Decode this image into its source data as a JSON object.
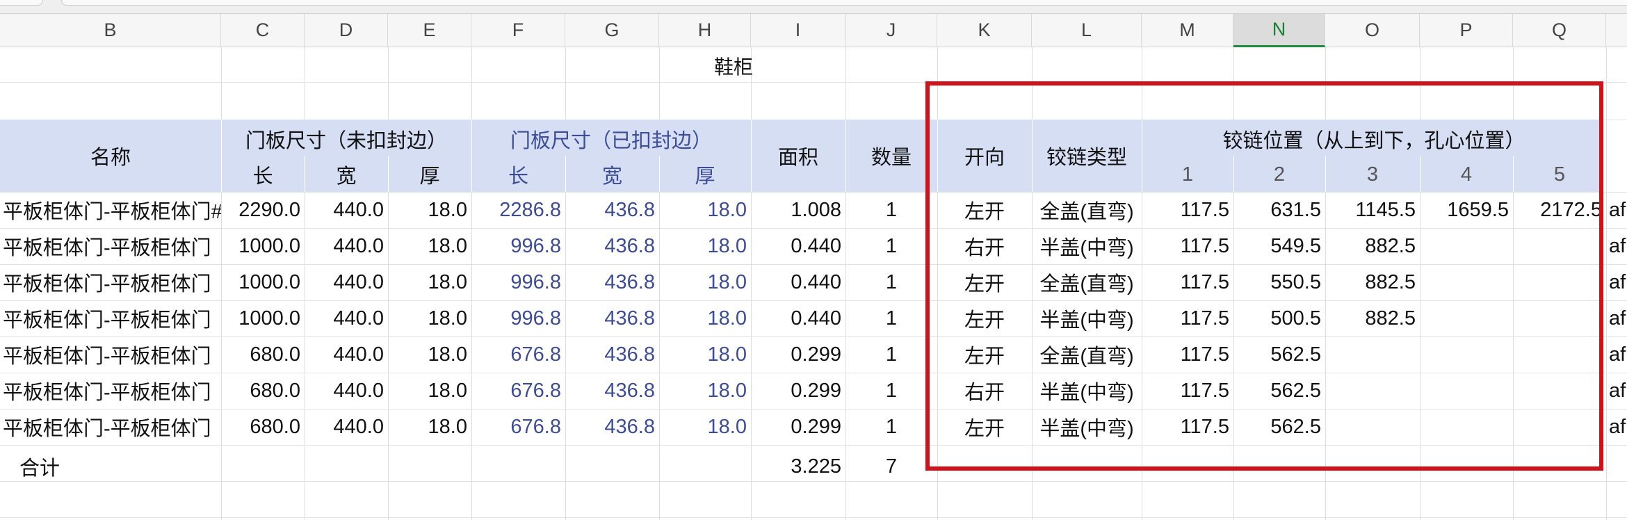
{
  "columns": [
    "B",
    "C",
    "D",
    "E",
    "F",
    "G",
    "H",
    "I",
    "J",
    "K",
    "L",
    "M",
    "N",
    "O",
    "P",
    "Q"
  ],
  "selected_column": "N",
  "sheet_title": "鞋柜",
  "header": {
    "name": "名称",
    "group_unsealed": "门板尺寸（未扣封边）",
    "group_sealed": "门板尺寸（已扣封边）",
    "length": "长",
    "width": "宽",
    "thickness": "厚",
    "area": "面积",
    "quantity": "数量",
    "direction": "开向",
    "hinge_type": "铰链类型",
    "hinge_position": "铰链位置（从上到下，孔心位置）",
    "positions": [
      "1",
      "2",
      "3",
      "4",
      "5"
    ]
  },
  "rows": [
    {
      "name": "平板柜体门-平板柜体门#",
      "l1": "2290.0",
      "w1": "440.0",
      "t1": "18.0",
      "l2": "2286.8",
      "w2": "436.8",
      "t2": "18.0",
      "area": "1.008",
      "qty": "1",
      "dir": "左开",
      "type": "全盖(直弯)",
      "p": [
        "117.5",
        "631.5",
        "1145.5",
        "1659.5",
        "2172.5"
      ],
      "extra": "af"
    },
    {
      "name": "平板柜体门-平板柜体门",
      "l1": "1000.0",
      "w1": "440.0",
      "t1": "18.0",
      "l2": "996.8",
      "w2": "436.8",
      "t2": "18.0",
      "area": "0.440",
      "qty": "1",
      "dir": "右开",
      "type": "半盖(中弯)",
      "p": [
        "117.5",
        "549.5",
        "882.5",
        "",
        ""
      ],
      "extra": "af"
    },
    {
      "name": "平板柜体门-平板柜体门",
      "l1": "1000.0",
      "w1": "440.0",
      "t1": "18.0",
      "l2": "996.8",
      "w2": "436.8",
      "t2": "18.0",
      "area": "0.440",
      "qty": "1",
      "dir": "左开",
      "type": "全盖(直弯)",
      "p": [
        "117.5",
        "550.5",
        "882.5",
        "",
        ""
      ],
      "extra": "af"
    },
    {
      "name": "平板柜体门-平板柜体门",
      "l1": "1000.0",
      "w1": "440.0",
      "t1": "18.0",
      "l2": "996.8",
      "w2": "436.8",
      "t2": "18.0",
      "area": "0.440",
      "qty": "1",
      "dir": "左开",
      "type": "半盖(中弯)",
      "p": [
        "117.5",
        "500.5",
        "882.5",
        "",
        ""
      ],
      "extra": "af"
    },
    {
      "name": "平板柜体门-平板柜体门",
      "l1": "680.0",
      "w1": "440.0",
      "t1": "18.0",
      "l2": "676.8",
      "w2": "436.8",
      "t2": "18.0",
      "area": "0.299",
      "qty": "1",
      "dir": "左开",
      "type": "全盖(直弯)",
      "p": [
        "117.5",
        "562.5",
        "",
        "",
        ""
      ],
      "extra": "af"
    },
    {
      "name": "平板柜体门-平板柜体门",
      "l1": "680.0",
      "w1": "440.0",
      "t1": "18.0",
      "l2": "676.8",
      "w2": "436.8",
      "t2": "18.0",
      "area": "0.299",
      "qty": "1",
      "dir": "右开",
      "type": "半盖(中弯)",
      "p": [
        "117.5",
        "562.5",
        "",
        "",
        ""
      ],
      "extra": "af"
    },
    {
      "name": "平板柜体门-平板柜体门",
      "l1": "680.0",
      "w1": "440.0",
      "t1": "18.0",
      "l2": "676.8",
      "w2": "436.8",
      "t2": "18.0",
      "area": "0.299",
      "qty": "1",
      "dir": "左开",
      "type": "半盖(中弯)",
      "p": [
        "117.5",
        "562.5",
        "",
        "",
        ""
      ],
      "extra": "af"
    }
  ],
  "total": {
    "label": "合计",
    "area": "3.225",
    "qty": "7"
  },
  "colors": {
    "header_band": "#d6def4",
    "highlight_box": "#d0121b",
    "sealed_text": "#3d4c96",
    "selected_column": "#1f8a3f"
  }
}
